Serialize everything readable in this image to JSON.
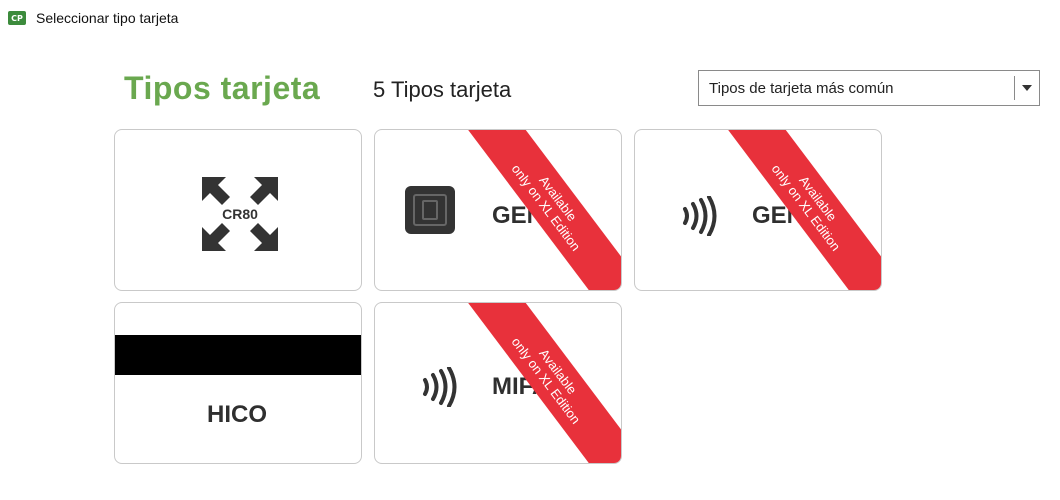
{
  "window": {
    "title": "Seleccionar tipo tarjeta",
    "icon": "app-logo-icon",
    "icon_text": "CP"
  },
  "header": {
    "title": "Tipos tarjeta",
    "count_label": "5 Tipos tarjeta"
  },
  "filter": {
    "selected": "Tipos de tarjeta más común"
  },
  "cards": [
    {
      "id": "cr80",
      "icon": "cr80-size-icon",
      "icon_text": "CR80",
      "label": "",
      "locked": false
    },
    {
      "id": "contact-chip",
      "icon": "contact-chip-icon",
      "label": "GENE",
      "locked": true
    },
    {
      "id": "contactless",
      "icon": "contactless-icon",
      "label": "GENE",
      "locked": true
    },
    {
      "id": "hico",
      "icon": "magnetic-stripe-icon",
      "label": "HICO",
      "locked": false
    },
    {
      "id": "mifare",
      "icon": "contactless-icon",
      "label": "MIFA",
      "locked": true
    }
  ],
  "ribbon": {
    "line1": "Available",
    "line2": "only on XL Edition"
  },
  "colors": {
    "accent_green": "#6aa84f",
    "ribbon_red": "#e8313b",
    "icon_dark": "#333333"
  }
}
